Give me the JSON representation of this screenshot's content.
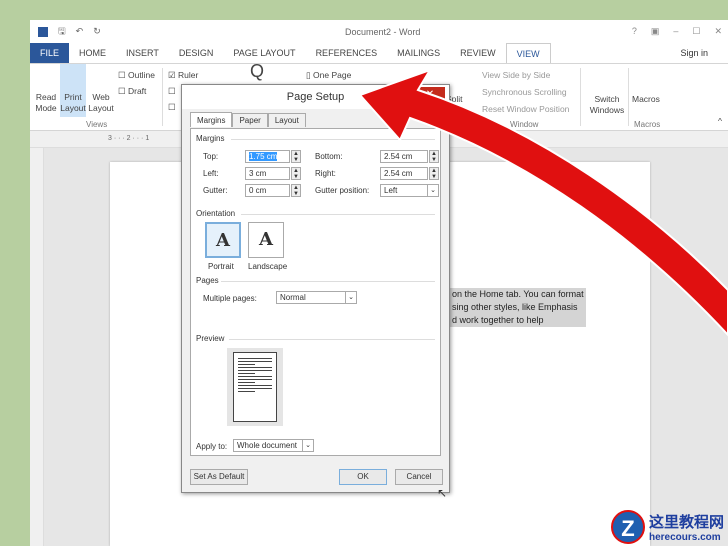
{
  "window": {
    "title": "Document2 - Word",
    "controls": [
      "?",
      "▣",
      "–",
      "☐",
      "✕"
    ]
  },
  "tabs": [
    "FILE",
    "HOME",
    "INSERT",
    "DESIGN",
    "PAGE LAYOUT",
    "REFERENCES",
    "MAILINGS",
    "REVIEW",
    "VIEW"
  ],
  "sign_in": "Sign in",
  "ribbon": {
    "read_mode": "Read Mode",
    "print_layout": "Print Layout",
    "web_layout": "Web Layout",
    "outline": "Outline",
    "draft": "Draft",
    "views_group": "Views",
    "ruler": "Ruler",
    "one_page": "One Page",
    "split": "Split",
    "view_side_by_side": "View Side by Side",
    "sync_scroll": "Synchronous Scrolling",
    "reset_window": "Reset Window Position",
    "window_group": "Window",
    "switch_windows": "Switch Windows",
    "macros": "Macros",
    "macros_group": "Macros"
  },
  "ruler_marks": "3 · · · 2 · · · 1",
  "document_lines": [
    "on the Home tab. You can format",
    "sing other styles, like Emphasis",
    "d work together to help"
  ],
  "dialog": {
    "title": "Page Setup",
    "close": "✕",
    "tabs": [
      "Margins",
      "Paper",
      "Layout"
    ],
    "margins_label": "Margins",
    "top_label": "Top:",
    "top": "1.75 cm",
    "bottom_label": "Bottom:",
    "bottom": "2.54 cm",
    "left_label": "Left:",
    "left": "3 cm",
    "right_label": "Right:",
    "right": "2.54 cm",
    "gutter_label": "Gutter:",
    "gutter": "0 cm",
    "gutter_pos_label": "Gutter position:",
    "gutter_pos": "Left",
    "orientation_label": "Orientation",
    "portrait": "Portrait",
    "landscape": "Landscape",
    "pages_label": "Pages",
    "multiple_pages_label": "Multiple pages:",
    "multiple_pages": "Normal",
    "preview_label": "Preview",
    "apply_to_label": "Apply to:",
    "apply_to": "Whole document",
    "set_default": "Set As Default",
    "ok": "OK",
    "cancel": "Cancel"
  },
  "watermark": {
    "cn": "这里教程网",
    "url": "herecours.com"
  },
  "colors": {
    "accent": "#2b579a",
    "arrow": "#e01010",
    "close": "#c42b1c"
  }
}
